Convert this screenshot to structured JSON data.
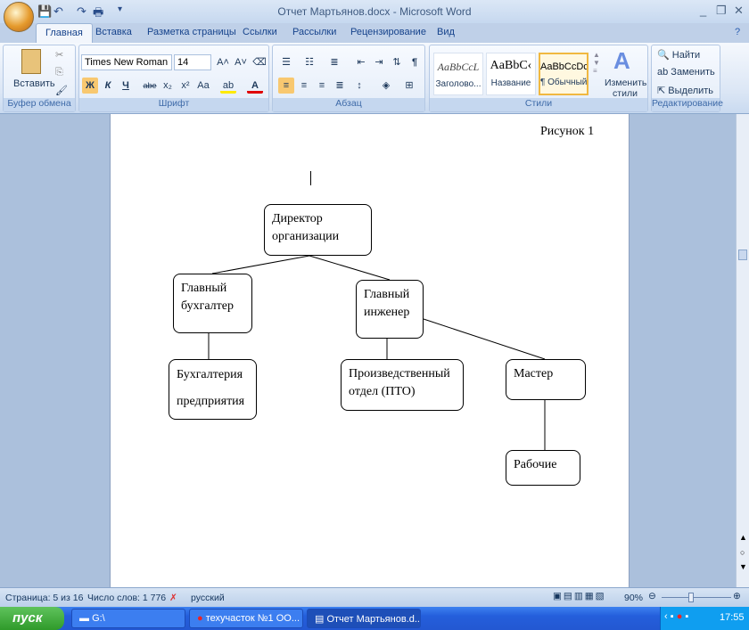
{
  "window": {
    "title": "Отчет Мартьянов.docx - Microsoft Word",
    "controls": [
      "_",
      "❐",
      "✕"
    ]
  },
  "quick_access": {
    "save": "💾",
    "undo": "↶",
    "redo": "↷",
    "print": "🖶",
    "customize": "▾"
  },
  "tabs": [
    "Главная",
    "Вставка",
    "Разметка страницы",
    "Ссылки",
    "Рассылки",
    "Рецензирование",
    "Вид"
  ],
  "ribbon": {
    "clipboard": {
      "label": "Буфер обмена",
      "paste": "Вставить"
    },
    "font": {
      "label": "Шрифт",
      "font_name": "Times New Roman",
      "font_size": "14",
      "bold": "Ж",
      "italic": "К",
      "underline": "Ч",
      "strike": "abe",
      "sub": "x₂",
      "sup": "x²",
      "case": "Aa",
      "grow": "A˄",
      "shrink": "A˅"
    },
    "paragraph": {
      "label": "Абзац"
    },
    "styles": {
      "label": "Стили",
      "items": [
        {
          "sample": "AaBbCcL",
          "name": "Заголово..."
        },
        {
          "sample": "AaBbC‹",
          "name": "Название"
        },
        {
          "sample": "AaBbCcDc",
          "name": "¶ Обычный"
        }
      ],
      "change": "Изменить стили"
    },
    "editing": {
      "label": "Редактирование",
      "find": "Найти",
      "replace": "Заменить",
      "select": "Выделить"
    }
  },
  "document": {
    "caption": "Рисунок 1",
    "boxes": {
      "director": "Директор организации",
      "chief_accountant": "Главный бухгалтер",
      "chief_engineer": "Главный инженер",
      "accounting": "Бухгалтерия предприятия",
      "pto": "Произведственный отдел (ПТО)",
      "master": "Мастер",
      "workers": "Рабочие"
    }
  },
  "status": {
    "page": "Страница: 5 из 16",
    "words": "Число слов: 1 776",
    "language": "русский",
    "zoom": "90%"
  },
  "taskbar": {
    "start": "пуск",
    "tasks": [
      "G:\\",
      "техучасток №1 ОО...",
      "Отчет Мартьянов.d..."
    ],
    "clock": "17:55"
  }
}
